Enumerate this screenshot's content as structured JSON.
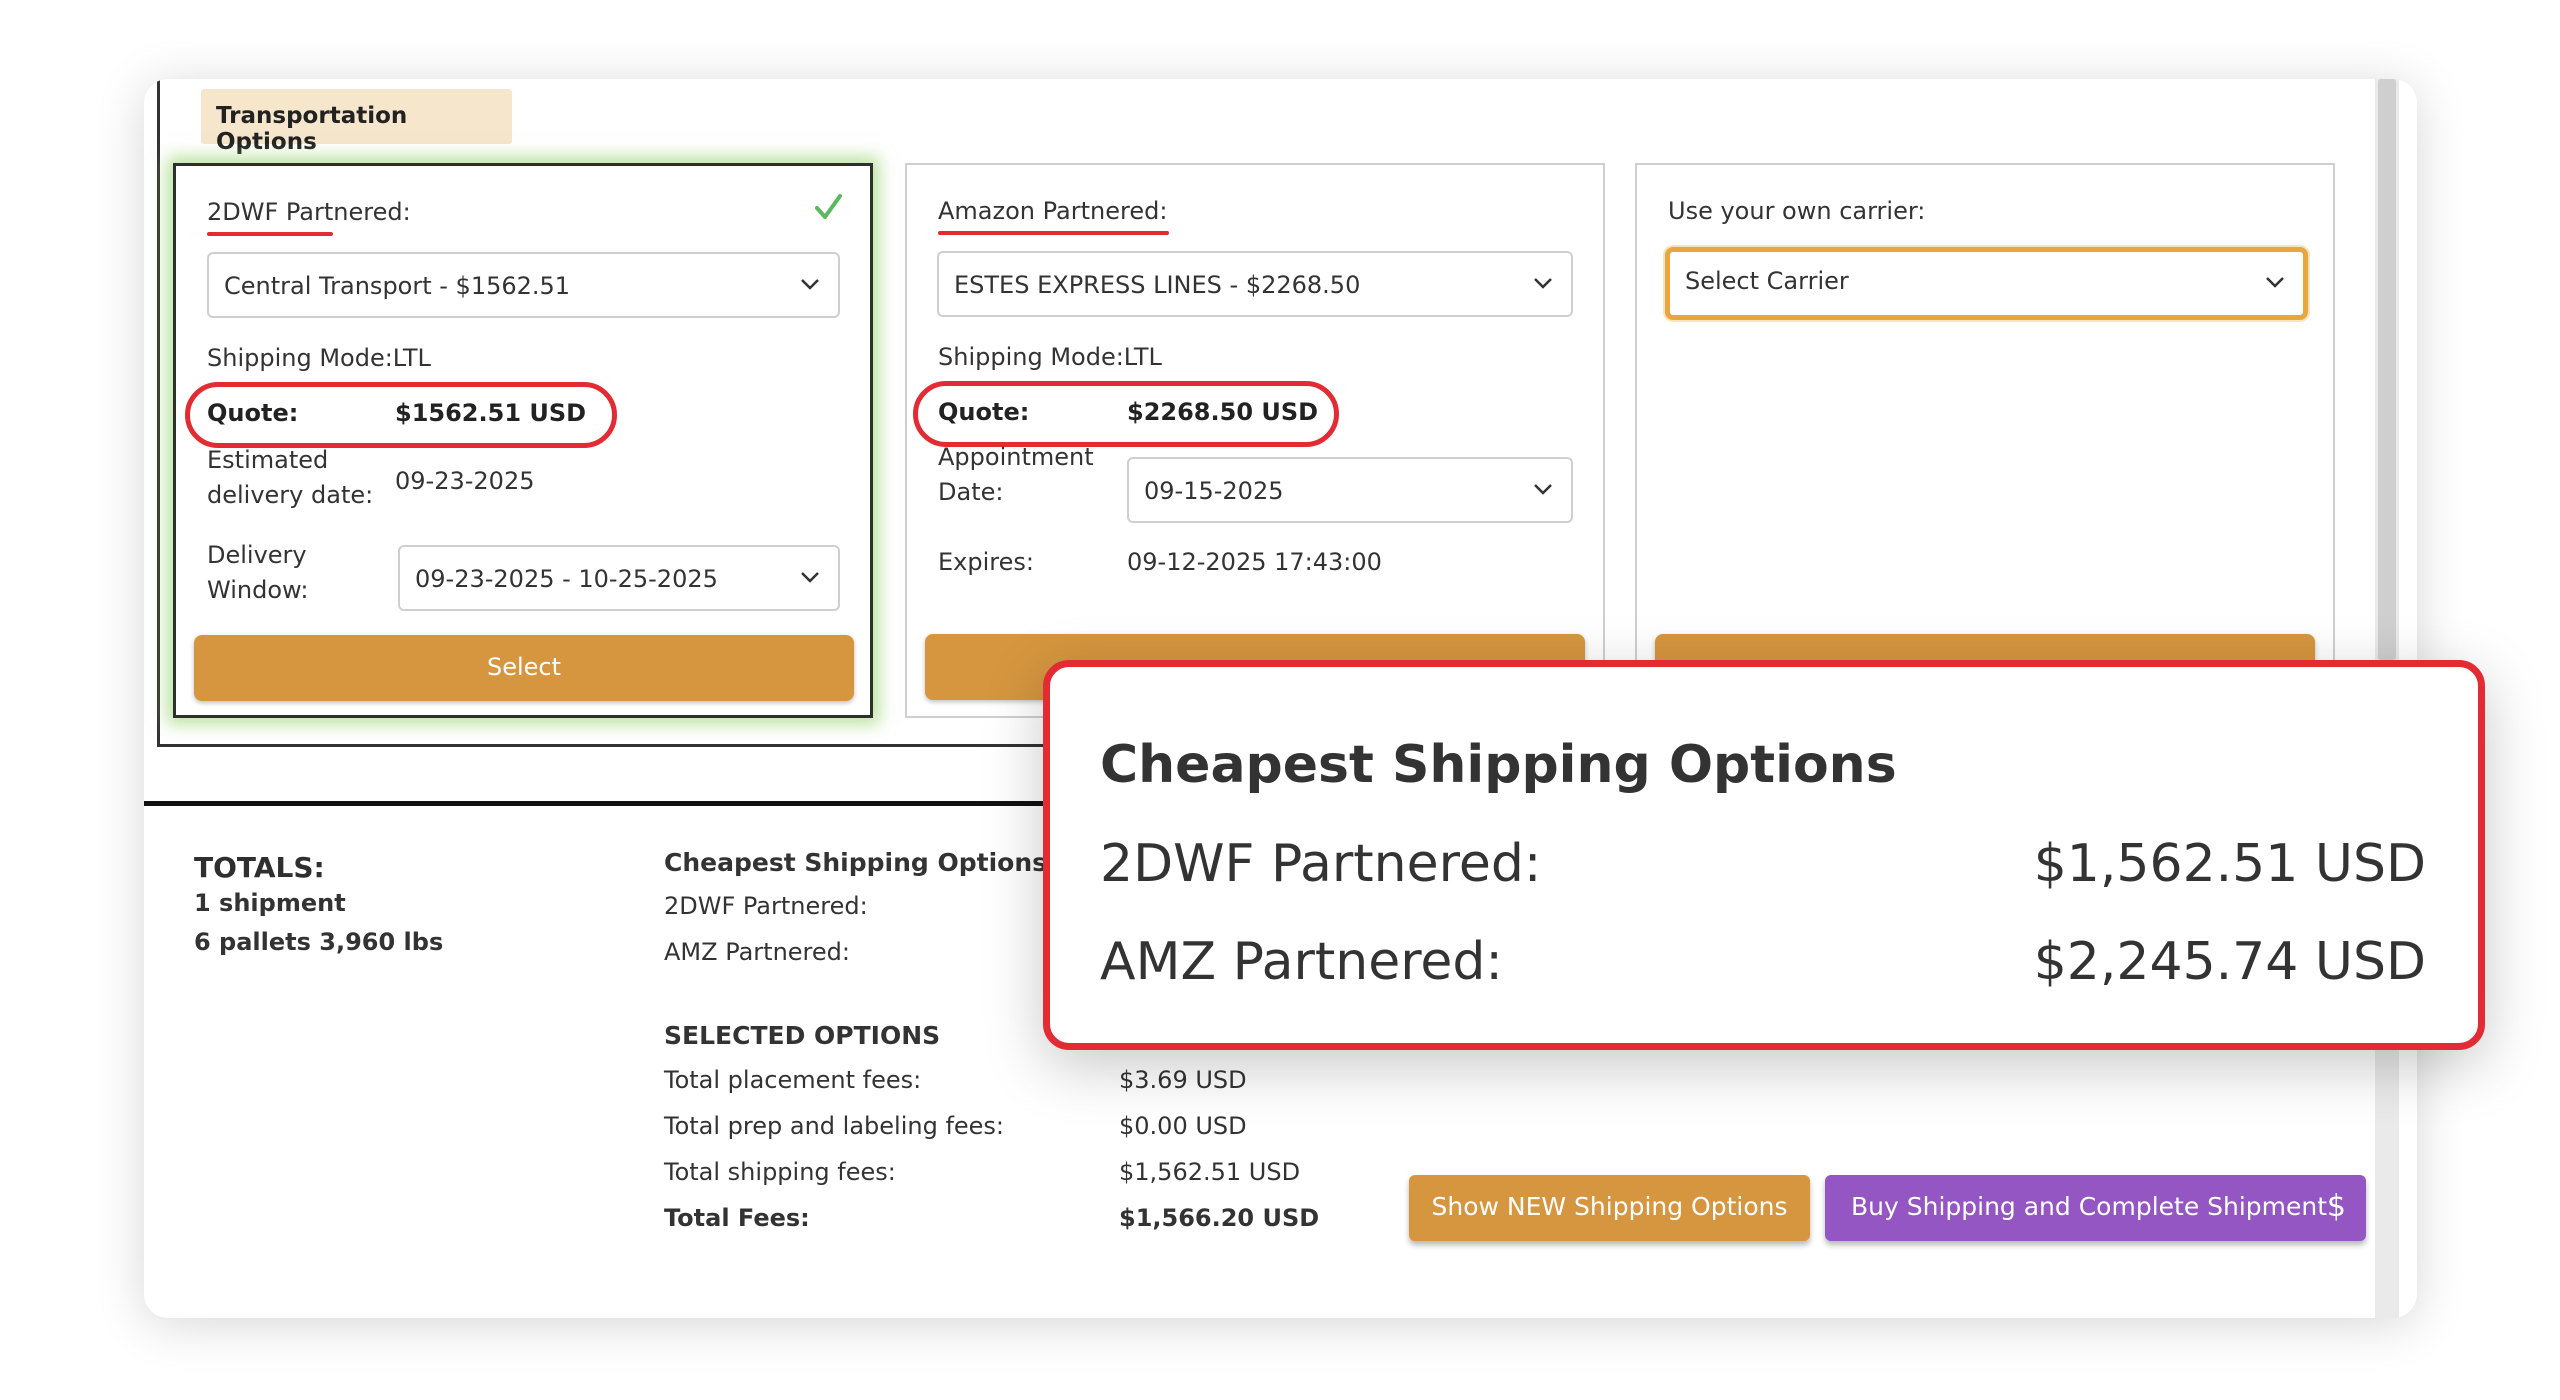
{
  "tab": {
    "label": "Transportation Options"
  },
  "panels": {
    "partnered_2dwf": {
      "label": "2DWF Partnered:",
      "carrier_select": "Central Transport - $1562.51",
      "shipping_mode": "Shipping Mode:LTL",
      "quote_label": "Quote:",
      "quote_value": "$1562.51 USD",
      "delivery_date_label": "Estimated delivery date:",
      "delivery_date_value": "09-23-2025",
      "window_label": "Delivery Window:",
      "window_value": "09-23-2025 - 10-25-2025",
      "select_label": "Select",
      "selected": true
    },
    "amazon": {
      "label": "Amazon Partnered:",
      "carrier_select": "ESTES EXPRESS LINES - $2268.50",
      "shipping_mode": "Shipping Mode:LTL",
      "quote_label": "Quote:",
      "quote_value": "$2268.50 USD",
      "appointment_label": "Appointment Date:",
      "appointment_value": "09-15-2025",
      "expires_label": "Expires:",
      "expires_value": "09-12-2025 17:43:00"
    },
    "own_carrier": {
      "label": "Use your own carrier:",
      "carrier_select": "Select Carrier"
    }
  },
  "totals": {
    "heading": "TOTALS:",
    "shipments": "1 shipment",
    "pallets": "6 pallets 3,960 lbs"
  },
  "cheapest": {
    "heading": "Cheapest Shipping Options",
    "row1_label": "2DWF Partnered:",
    "row2_label": "AMZ Partnered:"
  },
  "selected_options": {
    "heading": "SELECTED OPTIONS",
    "rows": [
      {
        "label": "Total placement fees:",
        "value": "$3.69 USD"
      },
      {
        "label": "Total prep and labeling fees:",
        "value": "$0.00 USD"
      },
      {
        "label": "Total shipping fees:",
        "value": "$1,562.51 USD"
      },
      {
        "label": "Total Fees:",
        "value": "$1,566.20 USD"
      }
    ]
  },
  "actions": {
    "show_new": "Show NEW Shipping Options",
    "buy": "Buy Shipping and Complete Shipment",
    "buy_icon": "$"
  },
  "callout": {
    "title": "Cheapest Shipping Options",
    "row1_label": "2DWF Partnered:",
    "row1_value": "$1,562.51 USD",
    "row2_label": "AMZ Partnered:",
    "row2_value": "$2,245.74 USD"
  },
  "colors": {
    "accent_orange": "#d6963f",
    "buy_purple": "#9356c2",
    "annotation_red": "#e32b34",
    "selected_glow_green": "#8ace5a",
    "check_green": "#5cb85c"
  }
}
